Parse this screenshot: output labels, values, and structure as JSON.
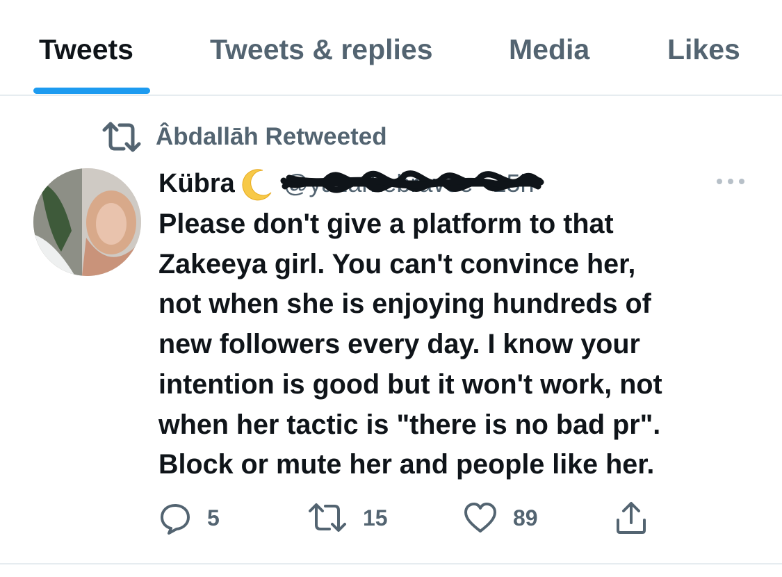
{
  "tabs": [
    {
      "label": "Tweets",
      "active": true
    },
    {
      "label": "Tweets & replies",
      "active": false
    },
    {
      "label": "Media",
      "active": false
    },
    {
      "label": "Likes",
      "active": false
    }
  ],
  "colors": {
    "accent": "#1d9bf0",
    "primary_text": "#0f1419",
    "secondary_text": "#536471",
    "divider": "#e6ecf0"
  },
  "tweet": {
    "retweet_context": "Âbdallāh Retweeted",
    "author": {
      "display_name": "Kübra",
      "name_emoji": "crescent-moon-icon",
      "handle_redacted": true
    },
    "time": "· 15h",
    "text": "Please don't give a platform to that\nZakeeya girl. You can't convince her,\nnot when she is enjoying hundreds of\nnew followers every day. I know your\nintention is good but it won't work, not\nwhen her tactic is \"there is no bad pr\".\nBlock or mute her and people like her.",
    "actions": {
      "reply": {
        "icon": "reply-icon",
        "count": "5"
      },
      "retweet": {
        "icon": "retweet-icon",
        "count": "15"
      },
      "like": {
        "icon": "heart-icon",
        "count": "89"
      },
      "share": {
        "icon": "share-icon"
      }
    }
  }
}
